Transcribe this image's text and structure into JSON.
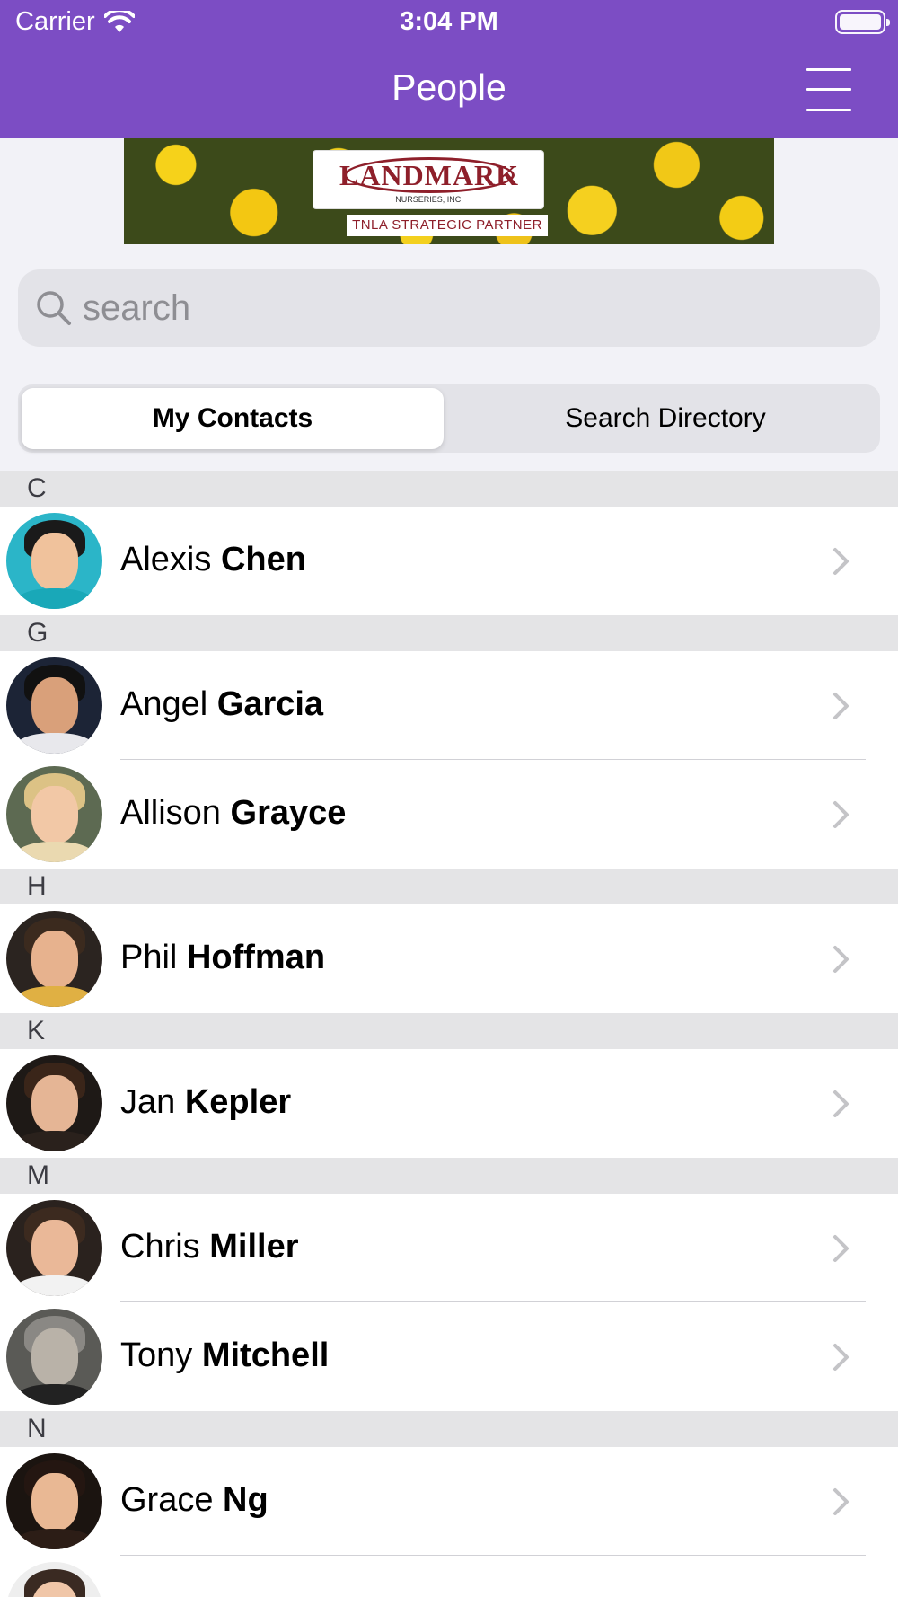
{
  "status": {
    "carrier": "Carrier",
    "time": "3:04 PM"
  },
  "header": {
    "title": "People"
  },
  "banner": {
    "brand": "LANDMARK",
    "sub": "NURSERIES, INC.",
    "partner": "TNLA STRATEGIC PARTNER"
  },
  "search": {
    "placeholder": "search",
    "value": ""
  },
  "segments": {
    "active": "My Contacts",
    "inactive": "Search Directory"
  },
  "sections": [
    {
      "letter": "C",
      "contacts": [
        {
          "first": "Alexis",
          "last": "Chen"
        }
      ]
    },
    {
      "letter": "G",
      "contacts": [
        {
          "first": "Angel",
          "last": "Garcia"
        },
        {
          "first": "Allison",
          "last": "Grayce"
        }
      ]
    },
    {
      "letter": "H",
      "contacts": [
        {
          "first": "Phil",
          "last": "Hoffman"
        }
      ]
    },
    {
      "letter": "K",
      "contacts": [
        {
          "first": "Jan",
          "last": "Kepler"
        }
      ]
    },
    {
      "letter": "M",
      "contacts": [
        {
          "first": "Chris",
          "last": "Miller"
        },
        {
          "first": "Tony",
          "last": "Mitchell"
        }
      ]
    },
    {
      "letter": "N",
      "contacts": [
        {
          "first": "Grace",
          "last": "Ng"
        }
      ]
    }
  ],
  "colors": {
    "header": "#7c4dc4",
    "section": "#e4e4e6",
    "chevron": "#c4c4c7"
  }
}
